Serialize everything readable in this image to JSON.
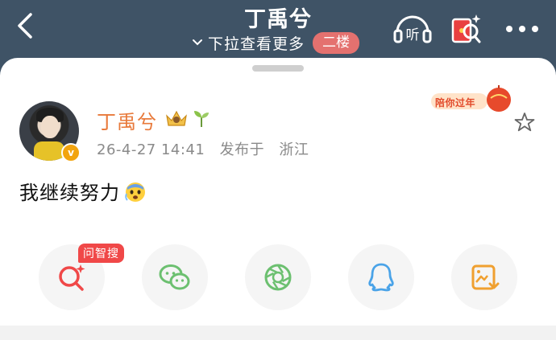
{
  "header": {
    "title": "丁禹兮",
    "subtitle": "下拉查看更多",
    "floor_badge": "二楼",
    "listen_label": "听"
  },
  "post": {
    "author": "丁禹兮",
    "timestamp": "26-4-27 14:41",
    "location_prefix": "发布于",
    "location": "浙江",
    "text": "我继续努力",
    "festival_badge": "陪你过年",
    "verify_mark": "v"
  },
  "share": {
    "ai_tag": "问智搜",
    "items": [
      {
        "icon": "ai-search-icon"
      },
      {
        "icon": "wechat-icon"
      },
      {
        "icon": "moments-icon"
      },
      {
        "icon": "qq-icon"
      },
      {
        "icon": "save-image-icon"
      }
    ]
  },
  "colors": {
    "header_bg": "#3f5366",
    "author": "#e8793a",
    "badge_red": "#e4716f",
    "ai_tag": "#f04848"
  }
}
